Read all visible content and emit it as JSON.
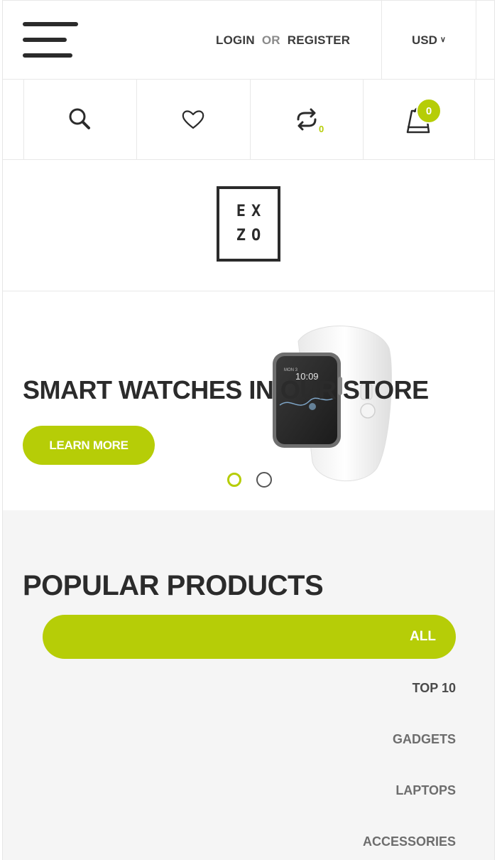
{
  "header": {
    "login_label": "LOGIN",
    "or_label": "OR",
    "register_label": "REGISTER",
    "currency": "USD"
  },
  "icons": {
    "compare_count": "0",
    "cart_count": "0"
  },
  "logo": {
    "line1": "EX",
    "line2": "ZO"
  },
  "hero": {
    "title": "SMART WATCHES IN OUR STORE",
    "button_label": "LEARN MORE",
    "active_slide": 1,
    "slide_count": 2
  },
  "popular": {
    "title": "POPULAR PRODUCTS",
    "tabs": [
      "ALL",
      "TOP 10",
      "GADGETS",
      "LAPTOPS",
      "ACCESSORIES"
    ],
    "active_tab": "ALL"
  },
  "colors": {
    "accent": "#b6cd07",
    "text": "#2b2b2b",
    "section_bg": "#f5f5f5"
  }
}
